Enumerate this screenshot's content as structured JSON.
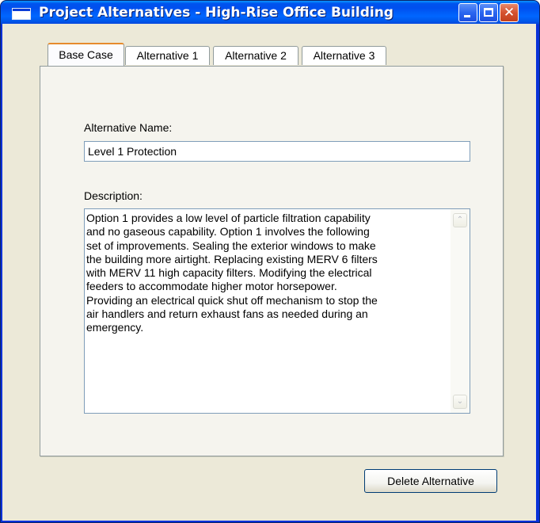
{
  "window": {
    "title": "Project Alternatives - High-Rise Office Building",
    "controls": {
      "minimize_icon": "minimize-icon",
      "maximize_icon": "maximize-icon",
      "close_glyph": "✕"
    }
  },
  "tabs": [
    {
      "label": "Base Case",
      "active": true
    },
    {
      "label": "Alternative 1",
      "active": false
    },
    {
      "label": "Alternative 2",
      "active": false
    },
    {
      "label": "Alternative 3",
      "active": false
    }
  ],
  "form": {
    "name_label": "Alternative Name:",
    "name_value": "Level 1 Protection",
    "description_label": "Description:",
    "description_value": "Option 1 provides a low level of particle filtration capability\nand no gaseous capability.  Option 1 involves the following\nset of improvements.  Sealing the exterior windows to make\nthe building more airtight.  Replacing existing MERV 6 filters\nwith MERV 11 high capacity filters.  Modifying the electrical\nfeeders to accommodate higher motor horsepower.\nProviding an electrical quick shut off mechanism to stop the\nair handlers and return exhaust fans as needed during an\nemergency."
  },
  "scrollbar": {
    "up_glyph": "⌃",
    "down_glyph": "⌄"
  },
  "actions": {
    "delete_label": "Delete Alternative"
  },
  "colors": {
    "title_bar": "#0055e8",
    "client_bg": "#ece9d8",
    "active_tab_highlight": "#e68b2c",
    "field_border": "#7f9db9"
  }
}
